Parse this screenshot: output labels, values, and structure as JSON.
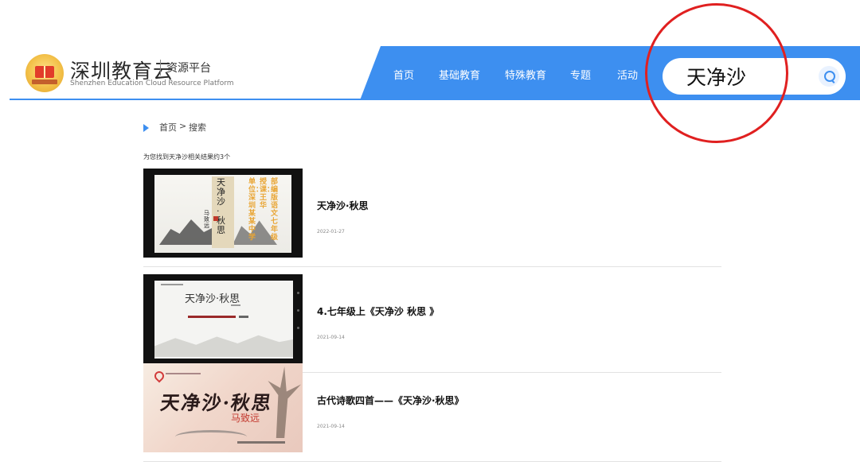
{
  "header": {
    "brand_cn": "深圳教育云",
    "brand_sub": "资源平台",
    "brand_en": "Shenzhen Education Cloud Resource Platform",
    "accent_color": "#3d8ff0",
    "nav": [
      {
        "label": "首页"
      },
      {
        "label": "基础教育"
      },
      {
        "label": "特殊教育"
      },
      {
        "label": "专题"
      },
      {
        "label": "活动"
      }
    ],
    "search": {
      "value": "天净沙",
      "icon": "search-icon"
    }
  },
  "breadcrumb": {
    "home": "首页",
    "separator": ">",
    "current": "搜索"
  },
  "result_count": "为您找到天净沙相关结果约3个",
  "results": [
    {
      "title": "天净沙·秋思",
      "date": "2022-01-27",
      "thumb_text": {
        "title_vertical": "天净沙·秋思",
        "author": "马致远",
        "cols": [
          "部编版语文七年级",
          "授课：王华",
          "单位：深圳某某中学"
        ]
      }
    },
    {
      "title": "4.七年级上《天净沙 秋思 》",
      "date": "2021-09-14",
      "thumb_text": {
        "title": "天净沙·秋思"
      }
    },
    {
      "title": "古代诗歌四首——《天净沙·秋思》",
      "date": "2021-09-14",
      "thumb_text": {
        "title": "天净沙·秋思",
        "author": "马致远"
      }
    }
  ]
}
